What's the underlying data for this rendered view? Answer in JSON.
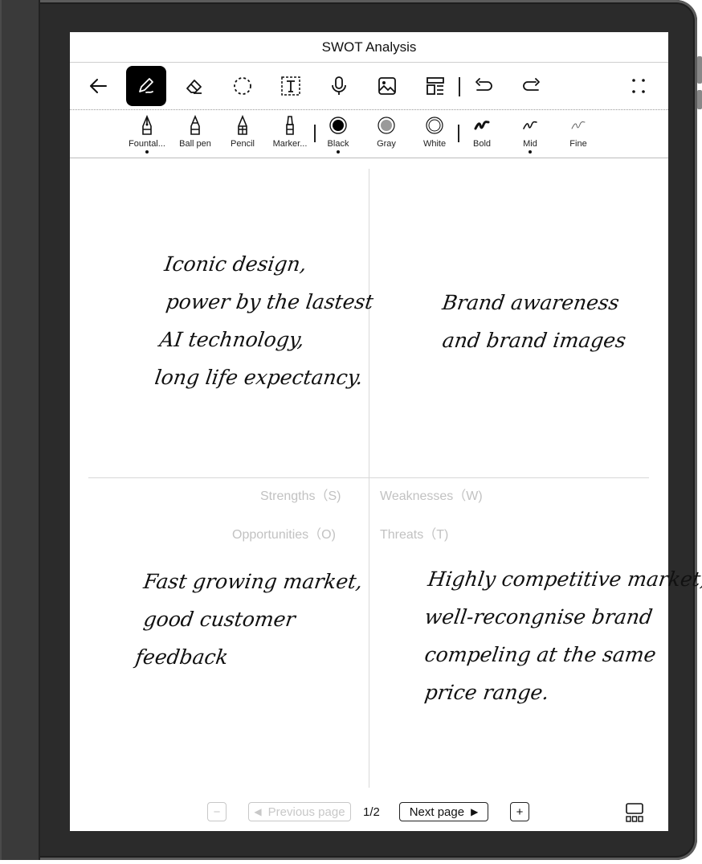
{
  "app": {
    "title": "SWOT Analysis"
  },
  "toolbar": {
    "tools": [
      {
        "name": "back-arrow-icon"
      },
      {
        "name": "pen-tool-icon",
        "active": true
      },
      {
        "name": "eraser-icon"
      },
      {
        "name": "lasso-icon"
      },
      {
        "name": "text-box-icon"
      },
      {
        "name": "microphone-icon"
      },
      {
        "name": "image-icon"
      },
      {
        "name": "template-icon"
      },
      {
        "name": "undo-icon"
      },
      {
        "name": "redo-icon"
      },
      {
        "name": "more-icon"
      }
    ]
  },
  "pen_panel": {
    "types": [
      "Fountal...",
      "Ball pen",
      "Pencil",
      "Marker..."
    ],
    "colors": [
      "Black",
      "Gray",
      "White"
    ],
    "widths": [
      "Bold",
      "Mid",
      "Fine"
    ],
    "selected": {
      "type": "Fountal...",
      "color": "Black",
      "width": "Mid"
    },
    "color_hex": {
      "Black": "#000000",
      "Gray": "#9a9a9a",
      "White": "#ffffff"
    }
  },
  "canvas": {
    "quadrants": {
      "strengths": {
        "label": "Strengths（S)",
        "notes": [
          "Iconic design,",
          "power by the lastest",
          "AI technology,",
          "long life expectancy."
        ]
      },
      "weaknesses": {
        "label": "Weaknesses（W)",
        "notes": [
          "Brand awareness",
          "and brand images"
        ]
      },
      "opportunities": {
        "label": "Opportunities（O)",
        "notes": [
          "Fast growing market,",
          "good customer",
          "feedback"
        ]
      },
      "threats": {
        "label": "Threats（T)",
        "notes": [
          "Highly competitive market,",
          "well-recongnise brand",
          "compeling at the same",
          "price range."
        ]
      }
    }
  },
  "footer": {
    "zoom_out": "−",
    "prev": "Previous page",
    "page_indicator": "1/2",
    "next": "Next page",
    "add_page": "+",
    "thumbnails": "thumbnails-icon"
  }
}
